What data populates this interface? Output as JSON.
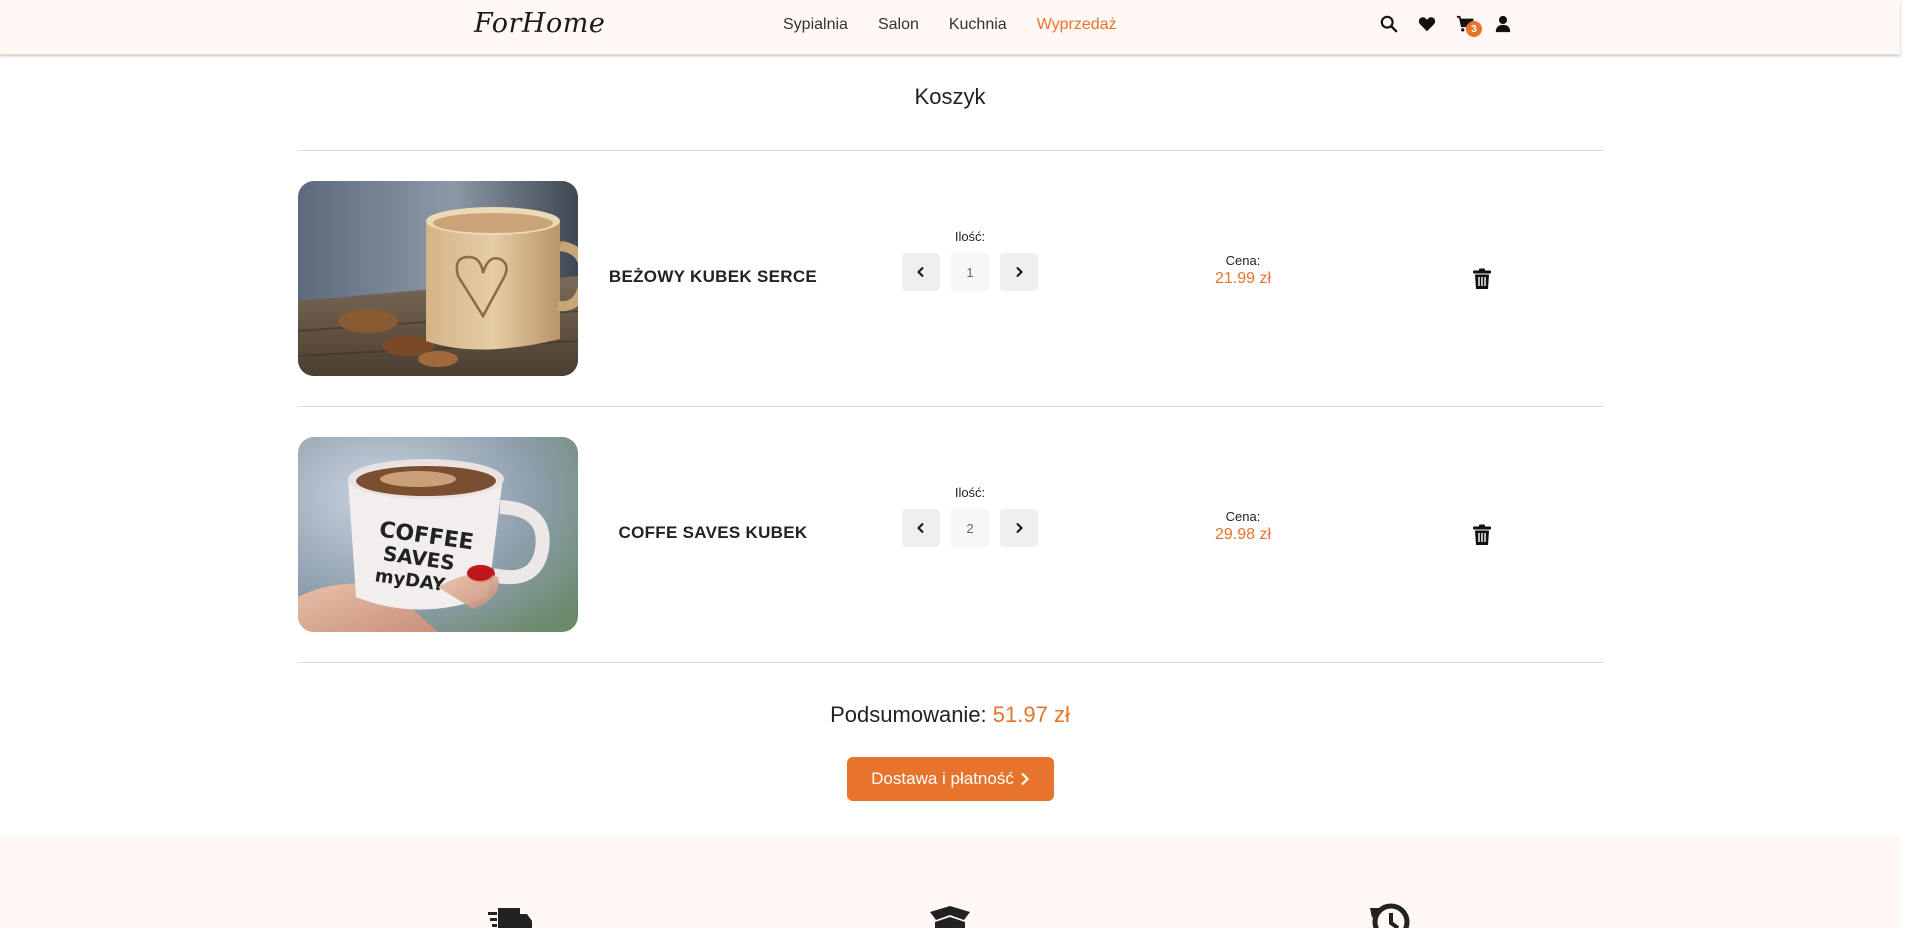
{
  "header": {
    "logo": "ForHome",
    "nav": [
      {
        "label": "Sypialnia"
      },
      {
        "label": "Salon"
      },
      {
        "label": "Kuchnia"
      },
      {
        "label": "Wyprzedaż"
      }
    ],
    "cart_count": "3"
  },
  "page_title": "Koszyk",
  "items": [
    {
      "name": "BEŻOWY KUBEK SERCE",
      "qty_label": "Ilość:",
      "qty": "1",
      "price_label": "Cena:",
      "price": "21.99 zł"
    },
    {
      "name": "COFFE SAVES KUBEK",
      "qty_label": "Ilość:",
      "qty": "2",
      "price_label": "Cena:",
      "price": "29.98 zł"
    }
  ],
  "summary": {
    "label": "Podsumowanie:",
    "amount": "51.97 zł"
  },
  "checkout_label": "Dostawa i płatność",
  "colors": {
    "accent": "#e8732d",
    "header_bg": "#fff8f4"
  },
  "icons": [
    "search-icon",
    "heart-icon",
    "cart-icon",
    "user-icon",
    "chevron-left-icon",
    "chevron-right-icon",
    "trash-icon",
    "truck-icon",
    "box-icon",
    "history-icon"
  ]
}
